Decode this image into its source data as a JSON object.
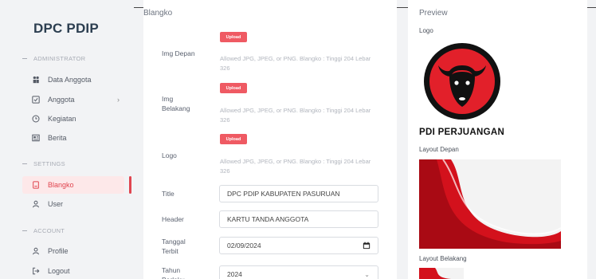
{
  "brand": "DPC PDIP",
  "sidebar": {
    "sections": [
      {
        "title": "ADMINISTRATOR"
      },
      {
        "title": "SETTINGS"
      },
      {
        "title": "ACCOUNT"
      }
    ],
    "items": [
      {
        "label": "Data Anggota",
        "icon": "users-icon"
      },
      {
        "label": "Anggota",
        "icon": "id-card-icon",
        "chevron": "›"
      },
      {
        "label": "Kegiatan",
        "icon": "clock-icon"
      },
      {
        "label": "Berita",
        "icon": "newspaper-icon"
      },
      {
        "label": "Blangko",
        "icon": "document-icon",
        "active": true
      },
      {
        "label": "User",
        "icon": "user-icon"
      },
      {
        "label": "Profile",
        "icon": "profile-icon"
      },
      {
        "label": "Logout",
        "icon": "logout-icon"
      }
    ]
  },
  "form": {
    "title": "Blangko",
    "upload_label": "Upload",
    "help_text": "Allowed JPG, JPEG, or PNG. Blangko : Tinggi 204 Lebar 326",
    "img_depan_label": "Img Depan",
    "img_belakang_label": "Img Belakang",
    "logo_label": "Logo",
    "title_label": "Title",
    "title_value": "DPC PDIP KABUPATEN PASURUAN",
    "header_label": "Header",
    "header_value": "KARTU TANDA ANGGOTA",
    "tanggal_label": "Tanggal Terbit",
    "tanggal_value": "02/09/2024",
    "tahun_label": "Tahun Berlaku",
    "tahun_value": "2024"
  },
  "preview": {
    "title": "Preview",
    "logo_label": "Logo",
    "logo_text": "PDI PERJUANGAN",
    "front_label": "Layout Depan",
    "back_label": "Layout Belakang"
  },
  "colors": {
    "accent": "#e0454f",
    "upload": "#ef5a63",
    "brand": "#2c3e50"
  }
}
